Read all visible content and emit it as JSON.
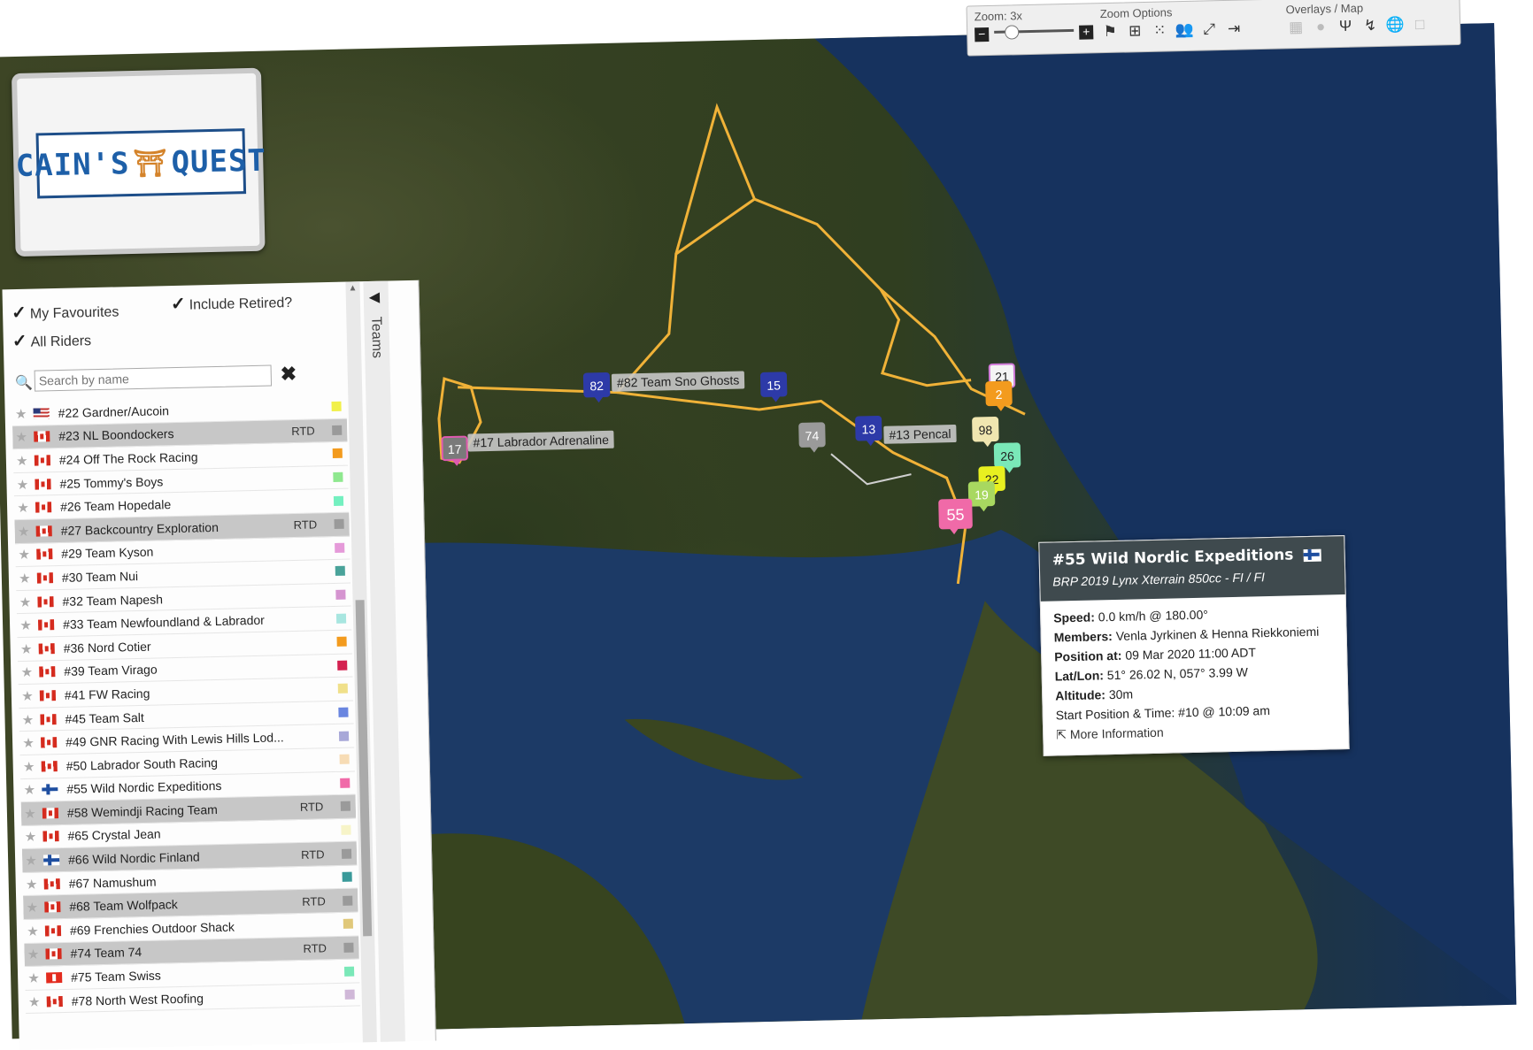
{
  "logo": {
    "left": "CAIN'S",
    "right": "QUEST"
  },
  "options": {
    "favourites": "My Favourites",
    "retired": "Include Retired?",
    "all": "All Riders"
  },
  "search": {
    "placeholder": "Search by name"
  },
  "side_tab": "Teams",
  "toolbar": {
    "zoom_label": "Zoom: 3x",
    "zoom_options_label": "Zoom Options",
    "overlays_label": "Overlays / Map"
  },
  "riders": [
    {
      "name": "#22 Gardner/Aucoin",
      "flag": "us",
      "rtd": "",
      "color": "#f1f04a"
    },
    {
      "name": "#23 NL Boondockers",
      "flag": "ca",
      "rtd": "RTD",
      "color": "#9a9a9a"
    },
    {
      "name": "#24 Off The Rock Racing",
      "flag": "ca",
      "rtd": "",
      "color": "#f39b1e"
    },
    {
      "name": "#25 Tommy's Boys",
      "flag": "ca",
      "rtd": "",
      "color": "#8fe88f"
    },
    {
      "name": "#26 Team Hopedale",
      "flag": "ca",
      "rtd": "",
      "color": "#74f0c0"
    },
    {
      "name": "#27 Backcountry Exploration",
      "flag": "ca",
      "rtd": "RTD",
      "color": "#9a9a9a"
    },
    {
      "name": "#29 Team Kyson",
      "flag": "ca",
      "rtd": "",
      "color": "#e59ad9"
    },
    {
      "name": "#30 Team Nui",
      "flag": "ca",
      "rtd": "",
      "color": "#4aa39a"
    },
    {
      "name": "#32 Team Napesh",
      "flag": "ca",
      "rtd": "",
      "color": "#d594d0"
    },
    {
      "name": "#33 Team Newfoundland & Labrador",
      "flag": "ca",
      "rtd": "",
      "color": "#a8e6e0"
    },
    {
      "name": "#36 Nord Cotier",
      "flag": "ca",
      "rtd": "",
      "color": "#f39b1e"
    },
    {
      "name": "#39 Team Virago",
      "flag": "ca",
      "rtd": "",
      "color": "#d42150"
    },
    {
      "name": "#41 FW Racing",
      "flag": "ca",
      "rtd": "",
      "color": "#f0e08a"
    },
    {
      "name": "#45 Team Salt",
      "flag": "ca",
      "rtd": "",
      "color": "#6a86e0"
    },
    {
      "name": "#49 GNR Racing With Lewis Hills Lod...",
      "flag": "ca",
      "rtd": "",
      "color": "#a8a8d8"
    },
    {
      "name": "#50 Labrador South Racing",
      "flag": "ca",
      "rtd": "",
      "color": "#f7dcb5"
    },
    {
      "name": "#55 Wild Nordic Expeditions",
      "flag": "fi",
      "rtd": "",
      "color": "#f06aa8"
    },
    {
      "name": "#58 Wemindji Racing Team",
      "flag": "ca",
      "rtd": "RTD",
      "color": "#9a9a9a"
    },
    {
      "name": "#65 Crystal Jean",
      "flag": "ca",
      "rtd": "",
      "color": "#f7f4c8"
    },
    {
      "name": "#66 Wild Nordic Finland",
      "flag": "fi",
      "rtd": "RTD",
      "color": "#9a9a9a"
    },
    {
      "name": "#67 Namushum",
      "flag": "ca",
      "rtd": "",
      "color": "#3a9a9a"
    },
    {
      "name": "#68 Team Wolfpack",
      "flag": "ca",
      "rtd": "RTD",
      "color": "#9a9a9a"
    },
    {
      "name": "#69 Frenchies Outdoor Shack",
      "flag": "ca",
      "rtd": "",
      "color": "#e0c87a"
    },
    {
      "name": "#74 Team 74",
      "flag": "ca",
      "rtd": "RTD",
      "color": "#9a9a9a"
    },
    {
      "name": "#75 Team Swiss",
      "flag": "ch",
      "rtd": "",
      "color": "#7ae8b8"
    },
    {
      "name": "#78 North West Roofing",
      "flag": "ca",
      "rtd": "",
      "color": "#d0b8d8"
    }
  ],
  "markers": [
    {
      "num": "82",
      "color": "#2d3aa8",
      "fill": "#2d3aa8",
      "label": "#82 Team Sno Ghosts"
    },
    {
      "num": "15",
      "color": "#2d3aa8",
      "fill": "#2d3aa8",
      "label": ""
    },
    {
      "num": "17",
      "color": "#e05ab0",
      "fill": "#7a7a7a",
      "label": "#17 Labrador Adrenaline"
    },
    {
      "num": "74",
      "color": "#9a9a9a",
      "fill": "#9a9a9a",
      "label": ""
    },
    {
      "num": "13",
      "color": "#2d3aa8",
      "fill": "#2d3aa8",
      "label": "#13 Pencal"
    },
    {
      "num": "21",
      "color": "#d07ad8",
      "fill": "#f4f4f4",
      "label": ""
    },
    {
      "num": "2",
      "color": "#f39b1e",
      "fill": "#f39b1e",
      "label": ""
    },
    {
      "num": "98",
      "color": "#f0e6b0",
      "fill": "#f0e6b0",
      "label": ""
    },
    {
      "num": "26",
      "color": "#7ae8b8",
      "fill": "#7ae8b8",
      "label": ""
    },
    {
      "num": "22",
      "color": "#e8f020",
      "fill": "#e8f020",
      "label": ""
    },
    {
      "num": "19",
      "color": "#a8d860",
      "fill": "#a8d860",
      "label": ""
    },
    {
      "num": "55",
      "color": "#f06aa8",
      "fill": "#f06aa8",
      "label": ""
    }
  ],
  "popup": {
    "title": "#55 Wild Nordic Expeditions",
    "subtitle": "BRP 2019 Lynx Xterrain 850cc - FI / FI",
    "speed_label": "Speed:",
    "speed": "0.0 km/h @ 180.00°",
    "members_label": "Members:",
    "members": "Venla Jyrkinen & Henna Riekkoniemi",
    "position_label": "Position at:",
    "position": "09 Mar 2020 11:00 ADT",
    "latlon_label": "Lat/Lon:",
    "latlon": "51° 26.02 N, 057° 3.99 W",
    "altitude_label": "Altitude:",
    "altitude": "30m",
    "start_label": "Start Position & Time:",
    "start": "#10 @ 10:09 am",
    "more": "More Information"
  }
}
